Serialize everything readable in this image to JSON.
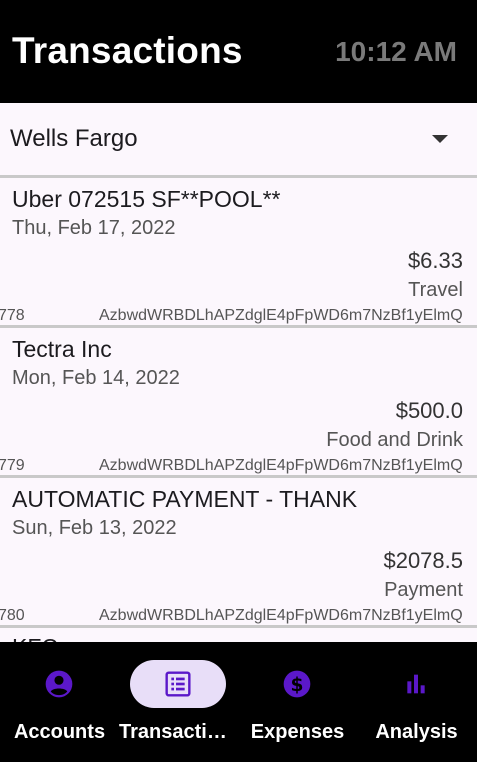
{
  "header": {
    "title": "Transactions",
    "clock": "10:12 AM"
  },
  "bank_select": {
    "selected": "Wells Fargo",
    "icon": "dropdown-caret-icon"
  },
  "transactions": [
    {
      "name": "Uber 072515 SF**POOL**",
      "date": "Thu, Feb 17, 2022",
      "amount": "$6.33",
      "category": "Travel",
      "id_left": "778",
      "id_right": "AzbwdWRBDLhAPZdglE4pFpWD6m7NzBf1yElmQ"
    },
    {
      "name": "Tectra Inc",
      "date": "Mon, Feb 14, 2022",
      "amount": "$500.0",
      "category": "Food and Drink",
      "id_left": "779",
      "id_right": "AzbwdWRBDLhAPZdglE4pFpWD6m7NzBf1yElmQ"
    },
    {
      "name": "AUTOMATIC PAYMENT - THANK",
      "date": "Sun, Feb 13, 2022",
      "amount": "$2078.5",
      "category": "Payment",
      "id_left": "780",
      "id_right": "AzbwdWRBDLhAPZdglE4pFpWD6m7NzBf1yElmQ"
    },
    {
      "name": "KFC"
    }
  ],
  "bottom_nav": {
    "accent": "#5b18c9",
    "items": [
      {
        "label": "Accounts",
        "icon": "account-circle-icon"
      },
      {
        "label": "Transactions",
        "icon": "receipt-list-icon"
      },
      {
        "label": "Expenses",
        "icon": "dollar-circle-icon"
      },
      {
        "label": "Analysis",
        "icon": "bar-chart-icon"
      }
    ]
  }
}
